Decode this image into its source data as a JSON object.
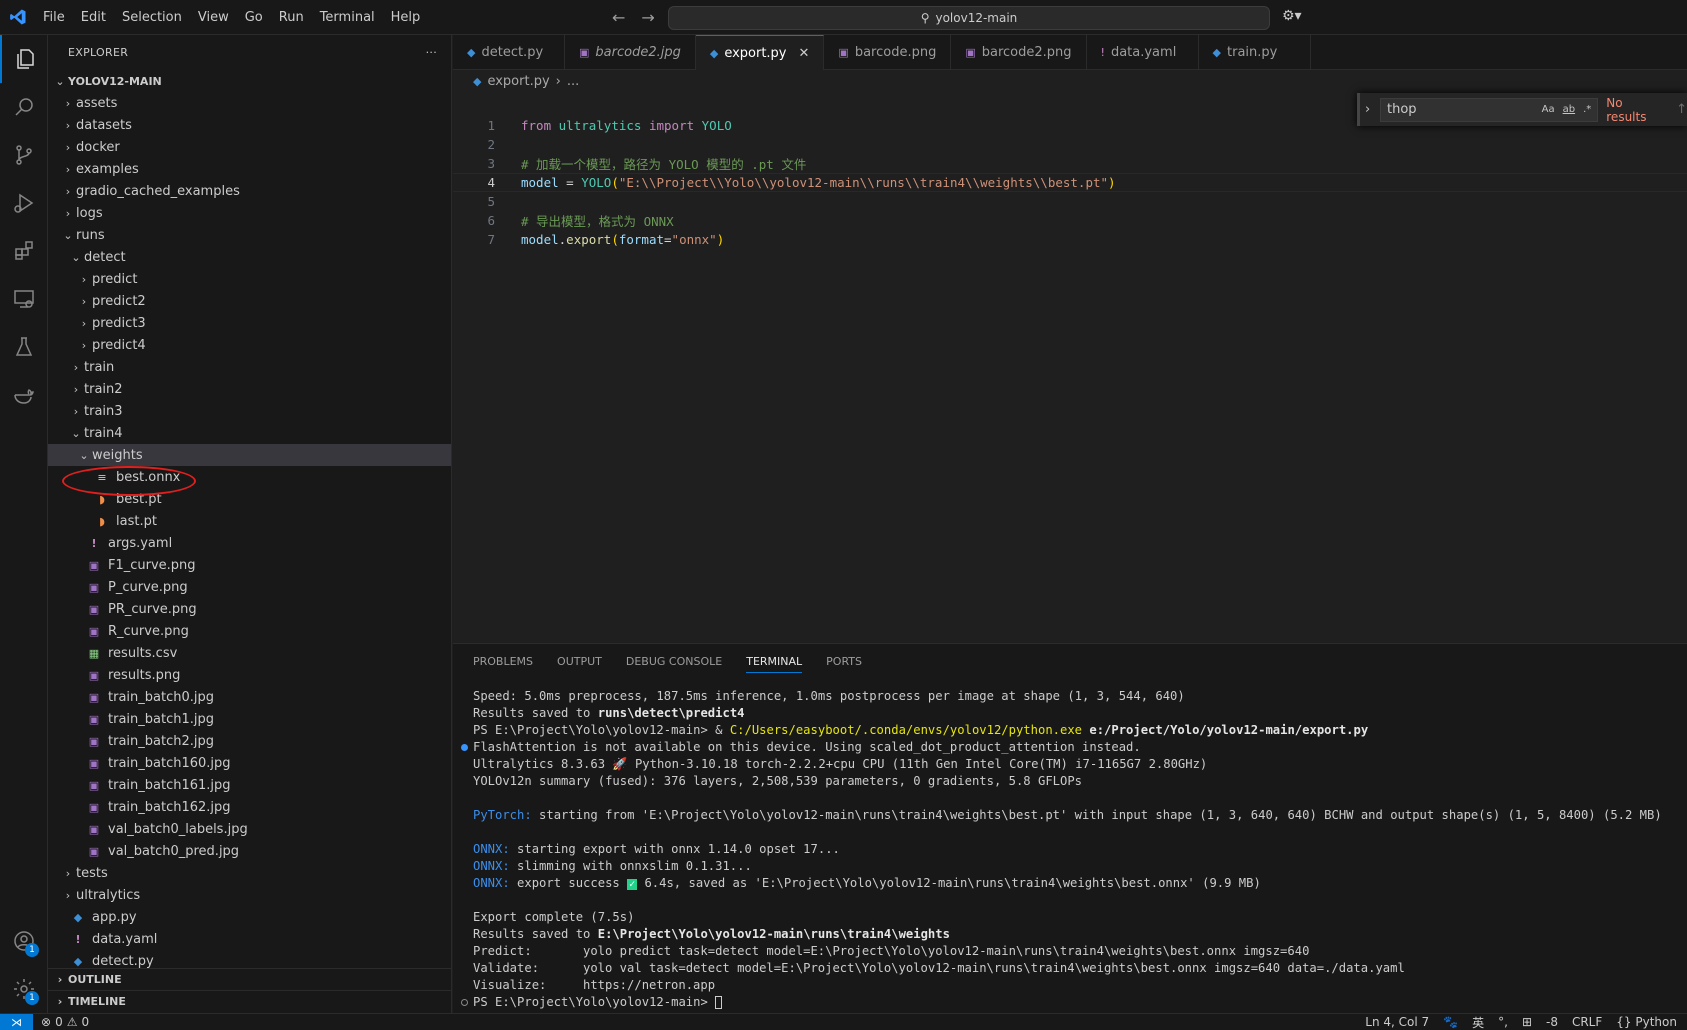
{
  "menu": [
    "File",
    "Edit",
    "Selection",
    "View",
    "Go",
    "Run",
    "Terminal",
    "Help"
  ],
  "search": {
    "value": "yolov12-main"
  },
  "sidebar": {
    "title": "EXPLORER",
    "project": "YOLOV12-MAIN",
    "tree": [
      {
        "depth": 0,
        "type": "folder",
        "open": false,
        "label": "assets"
      },
      {
        "depth": 0,
        "type": "folder",
        "open": false,
        "label": "datasets"
      },
      {
        "depth": 0,
        "type": "folder",
        "open": false,
        "label": "docker"
      },
      {
        "depth": 0,
        "type": "folder",
        "open": false,
        "label": "examples"
      },
      {
        "depth": 0,
        "type": "folder",
        "open": false,
        "label": "gradio_cached_examples"
      },
      {
        "depth": 0,
        "type": "folder",
        "open": false,
        "label": "logs"
      },
      {
        "depth": 0,
        "type": "folder",
        "open": true,
        "label": "runs"
      },
      {
        "depth": 1,
        "type": "folder",
        "open": true,
        "label": "detect"
      },
      {
        "depth": 2,
        "type": "folder",
        "open": false,
        "label": "predict"
      },
      {
        "depth": 2,
        "type": "folder",
        "open": false,
        "label": "predict2"
      },
      {
        "depth": 2,
        "type": "folder",
        "open": false,
        "label": "predict3"
      },
      {
        "depth": 2,
        "type": "folder",
        "open": false,
        "label": "predict4"
      },
      {
        "depth": 1,
        "type": "folder",
        "open": false,
        "label": "train"
      },
      {
        "depth": 1,
        "type": "folder",
        "open": false,
        "label": "train2"
      },
      {
        "depth": 1,
        "type": "folder",
        "open": false,
        "label": "train3"
      },
      {
        "depth": 1,
        "type": "folder",
        "open": true,
        "label": "train4"
      },
      {
        "depth": 2,
        "type": "folder",
        "open": true,
        "label": "weights",
        "selected": true
      },
      {
        "depth": 3,
        "type": "onnx",
        "label": "best.onnx"
      },
      {
        "depth": 3,
        "type": "rss",
        "label": "best.pt"
      },
      {
        "depth": 3,
        "type": "rss",
        "label": "last.pt"
      },
      {
        "depth": 2,
        "type": "yaml",
        "label": "args.yaml"
      },
      {
        "depth": 2,
        "type": "img",
        "label": "F1_curve.png"
      },
      {
        "depth": 2,
        "type": "img",
        "label": "P_curve.png"
      },
      {
        "depth": 2,
        "type": "img",
        "label": "PR_curve.png"
      },
      {
        "depth": 2,
        "type": "img",
        "label": "R_curve.png"
      },
      {
        "depth": 2,
        "type": "csv",
        "label": "results.csv"
      },
      {
        "depth": 2,
        "type": "img",
        "label": "results.png"
      },
      {
        "depth": 2,
        "type": "img",
        "label": "train_batch0.jpg"
      },
      {
        "depth": 2,
        "type": "img",
        "label": "train_batch1.jpg"
      },
      {
        "depth": 2,
        "type": "img",
        "label": "train_batch2.jpg"
      },
      {
        "depth": 2,
        "type": "img",
        "label": "train_batch160.jpg"
      },
      {
        "depth": 2,
        "type": "img",
        "label": "train_batch161.jpg"
      },
      {
        "depth": 2,
        "type": "img",
        "label": "train_batch162.jpg"
      },
      {
        "depth": 2,
        "type": "img",
        "label": "val_batch0_labels.jpg"
      },
      {
        "depth": 2,
        "type": "img",
        "label": "val_batch0_pred.jpg"
      },
      {
        "depth": 0,
        "type": "folder",
        "open": false,
        "label": "tests"
      },
      {
        "depth": 0,
        "type": "folder",
        "open": false,
        "label": "ultralytics"
      },
      {
        "depth": 0,
        "type": "py",
        "label": "app.py"
      },
      {
        "depth": 0,
        "type": "yaml",
        "label": "data.yaml"
      },
      {
        "depth": 0,
        "type": "py",
        "label": "detect.py"
      }
    ],
    "outline": "OUTLINE",
    "timeline": "TIMELINE"
  },
  "tabs": [
    {
      "label": "detect.py",
      "icon": "py"
    },
    {
      "label": "barcode2.jpg",
      "icon": "img",
      "italic": true
    },
    {
      "label": "export.py",
      "icon": "py",
      "active": true
    },
    {
      "label": "barcode.png",
      "icon": "img"
    },
    {
      "label": "barcode2.png",
      "icon": "img"
    },
    {
      "label": "data.yaml",
      "icon": "yaml"
    },
    {
      "label": "train.py",
      "icon": "py"
    }
  ],
  "breadcrumb": {
    "file": "export.py",
    "rest": "..."
  },
  "find": {
    "value": "thop",
    "opt_case": "Aa",
    "opt_word": "ab",
    "opt_regex": ".*",
    "status": "No results"
  },
  "editor": {
    "line_numbers": [
      "1",
      "2",
      "3",
      "4",
      "5",
      "6",
      "7"
    ],
    "l1": {
      "kw1": "from",
      "mod": "ultralytics",
      "kw2": "import",
      "cls": "YOLO"
    },
    "l3": {
      "comment": "# 加载一个模型，路径为 YOLO 模型的 .pt 文件"
    },
    "l4": {
      "var": "model",
      "op": " = ",
      "cls": "YOLO",
      "open": "(",
      "str": "\"E:\\\\Project\\\\Yolo\\\\yolov12-main\\\\runs\\\\train4\\\\weights\\\\best.pt\"",
      "close": ")"
    },
    "l6": {
      "comment": "# 导出模型，格式为 ONNX"
    },
    "l7": {
      "var": "model",
      "dot": ".",
      "fn": "export",
      "open": "(",
      "param": "format",
      "eq": "=",
      "str": "\"onnx\"",
      "close": ")"
    }
  },
  "panel": {
    "tabs": [
      "PROBLEMS",
      "OUTPUT",
      "DEBUG CONSOLE",
      "TERMINAL",
      "PORTS"
    ],
    "active_tab": "TERMINAL",
    "term": {
      "l1": "Speed: 5.0ms preprocess, 187.5ms inference, 1.0ms postprocess per image at shape (1, 3, 544, 640)",
      "l2a": "Results saved to ",
      "l2b": "runs\\detect\\predict4",
      "l3a": "PS E:\\Project\\Yolo\\yolov12-main> & ",
      "l3b": "C:/Users/easyboot/.conda/envs/yolov12/python.exe",
      "l3c": " e:/Project/Yolo/yolov12-main/export.py",
      "l4": "FlashAttention is not available on this device. Using scaled_dot_product_attention instead.",
      "l5a": "Ultralytics 8.3.63 ",
      "l5b": "🚀",
      "l5c": " Python-3.10.18 torch-2.2.2+cpu CPU (11th Gen Intel Core(TM) i7-1165G7 2.80GHz)",
      "l6": "YOLOv12n summary (fused): 376 layers, 2,508,539 parameters, 0 gradients, 5.8 GFLOPs",
      "l7a": "PyTorch:",
      "l7b": " starting from 'E:\\Project\\Yolo\\yolov12-main\\runs\\train4\\weights\\best.pt' with input shape (1, 3, 640, 640) BCHW and output shape(s) (1, 5, 8400) (5.2 MB)",
      "l8a": "ONNX:",
      "l8b": " starting export with onnx 1.14.0 opset 17...",
      "l9a": "ONNX:",
      "l9b": " slimming with onnxslim 0.1.31...",
      "l10a": "ONNX:",
      "l10b": " export success ",
      "l10c": "✓",
      "l10d": " 6.4s, saved as 'E:\\Project\\Yolo\\yolov12-main\\runs\\train4\\weights\\best.onnx' (9.9 MB)",
      "l11": "Export complete (7.5s)",
      "l12a": "Results saved to ",
      "l12b": "E:\\Project\\Yolo\\yolov12-main\\runs\\train4\\weights",
      "l13a": "Predict:",
      "l13b": "yolo predict task=detect model=E:\\Project\\Yolo\\yolov12-main\\runs\\train4\\weights\\best.onnx imgsz=640",
      "l14a": "Validate:",
      "l14b": "yolo val task=detect model=E:\\Project\\Yolo\\yolov12-main\\runs\\train4\\weights\\best.onnx imgsz=640 data=./data.yaml",
      "l15a": "Visualize:",
      "l15b": "https://netron.app",
      "l16": "PS E:\\Project\\Yolo\\yolov12-main> "
    }
  },
  "status": {
    "errors": "0",
    "warnings": "0",
    "position": "Ln 4, Col 7",
    "ime": "英",
    "encoding": "-8",
    "eol": "CRLF",
    "language": "Python"
  },
  "badges": {
    "account": "1",
    "settings": "1"
  },
  "colors": {
    "accent": "#0078d4",
    "annotation": "#e0201e"
  }
}
